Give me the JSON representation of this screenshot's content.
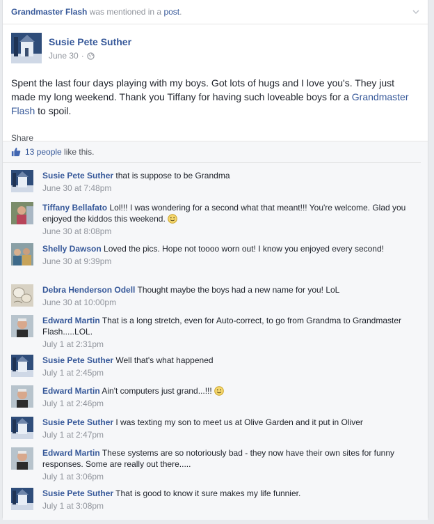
{
  "mention": {
    "name": "Grandmaster Flash",
    "text1": " was mentioned in a ",
    "link": "post",
    "text2": "."
  },
  "post": {
    "author": "Susie Pete Suther",
    "date": "June 30",
    "sep": "·",
    "text_before": "Spent the last four days playing with my boys. Got lots of hugs and I love you's. They just made my long weekend. Thank you Tiffany for having such loveable boys for a ",
    "text_link": "Grandmaster Flash",
    "text_after": " to spoil.",
    "share": "Share"
  },
  "likes": {
    "count": "13 people",
    "suffix": " like this."
  },
  "comments": [
    {
      "name": "Susie Pete Suther",
      "text": "that is suppose to be Grandma",
      "time": "June 30 at 7:48pm"
    },
    {
      "name": "Tiffany Bellafato",
      "text": "Lol!!! I was wondering for a second what that meant!!! You're welcome. Glad you enjoyed the kiddos this weekend.",
      "time": "June 30 at 8:08pm"
    },
    {
      "name": "Shelly Dawson",
      "text": "Loved the pics. Hope not toooo worn out! I know you enjoyed every second!",
      "time": "June 30 at 9:39pm"
    },
    {
      "name": "Debra Henderson Odell",
      "text": "Thought maybe the boys had a new name for you! LoL",
      "time": "June 30 at 10:00pm"
    },
    {
      "name": "Edward Martin",
      "text": "That is a long stretch, even for Auto-correct, to go from Grandma to Grandmaster Flash.....LOL.",
      "time": "July 1 at 2:31pm"
    },
    {
      "name": "Susie Pete Suther",
      "text": "Well that's what happened",
      "time": "July 1 at 2:45pm"
    },
    {
      "name": "Edward Martin",
      "text": "Ain't computers just grand...!!!",
      "time": "July 1 at 2:46pm"
    },
    {
      "name": "Susie Pete Suther",
      "text": "I was texting my son to meet us at Olive Garden and it put in Oliver",
      "time": "July 1 at 2:47pm"
    },
    {
      "name": "Edward Martin",
      "text": "These systems are so notoriously bad - they now have their own sites for funny responses. Some are really out there.....",
      "time": "July 1 at 3:06pm"
    },
    {
      "name": "Susie Pete Suther",
      "text": "That is good to know it sure makes my life funnier.",
      "time": "July 1 at 3:08pm"
    }
  ],
  "colors": {
    "link": "#365899",
    "meta": "#90949c",
    "feedback_bg": "#f6f7f9"
  }
}
